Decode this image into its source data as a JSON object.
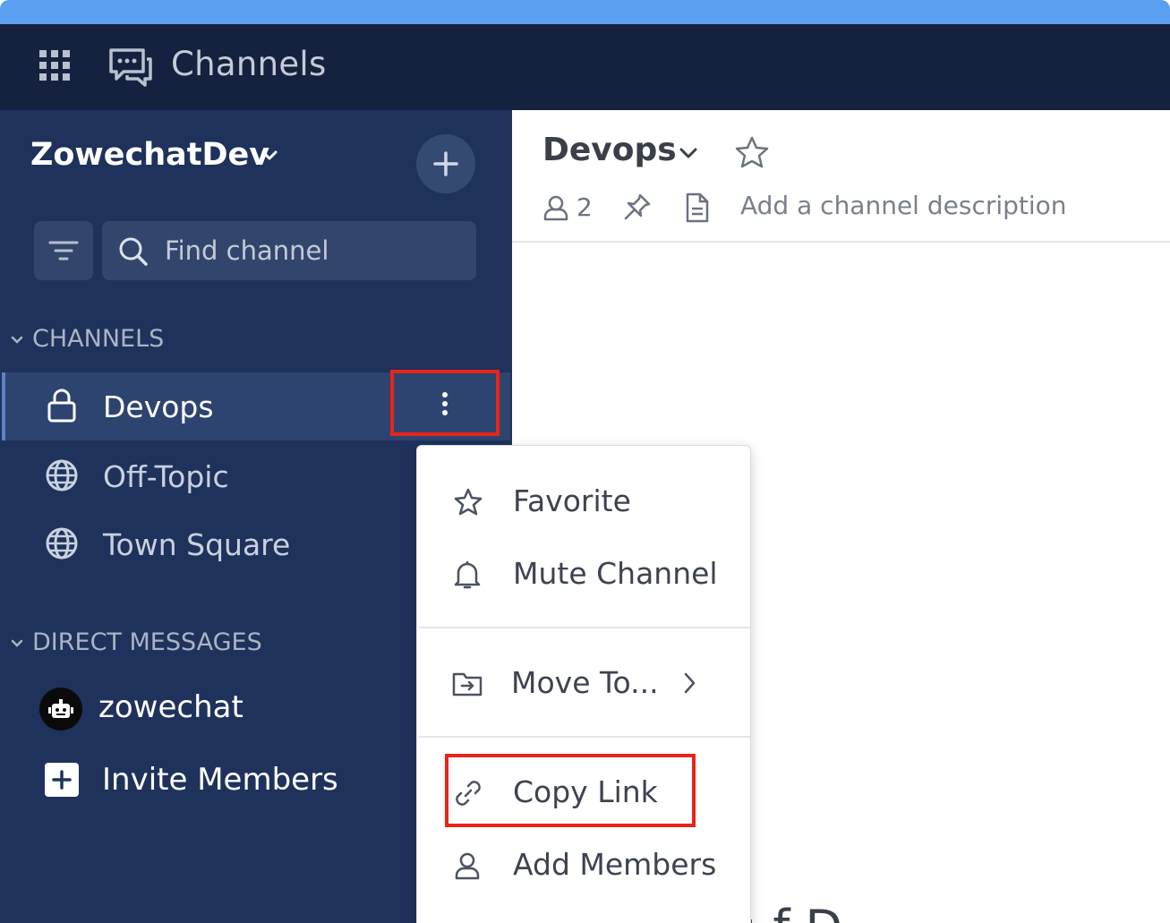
{
  "app": {
    "title": "Channels",
    "accent_color": "#5a9ff0",
    "header_color": "#15223f",
    "sidebar_color": "#1e325c"
  },
  "sidebar": {
    "team_name": "ZowechatDev",
    "search_placeholder": "Find channel",
    "channels_header": "CHANNELS",
    "channels": [
      {
        "label": "Devops",
        "icon": "lock-icon",
        "active": true
      },
      {
        "label": "Off-Topic",
        "icon": "globe-icon",
        "active": false
      },
      {
        "label": "Town Square",
        "icon": "globe-icon",
        "active": false
      }
    ],
    "dm_header": "DIRECT MESSAGES",
    "dms": [
      {
        "label": "zowechat",
        "icon": "bot-avatar-icon"
      }
    ],
    "invite_label": "Invite Members"
  },
  "channel": {
    "name": "Devops",
    "member_count": "2",
    "description_placeholder": "Add a channel description"
  },
  "menu": {
    "items": [
      {
        "label": "Favorite",
        "icon": "star-icon"
      },
      {
        "label": "Mute Channel",
        "icon": "bell-icon"
      },
      {
        "label": "Move To...",
        "icon": "folder-move-icon",
        "submenu": true
      },
      {
        "label": "Copy Link",
        "icon": "link-icon",
        "highlighted": true
      },
      {
        "label": "Add Members",
        "icon": "person-icon"
      }
    ]
  },
  "highlight_color": "#e8251b",
  "background_text": "; f D"
}
